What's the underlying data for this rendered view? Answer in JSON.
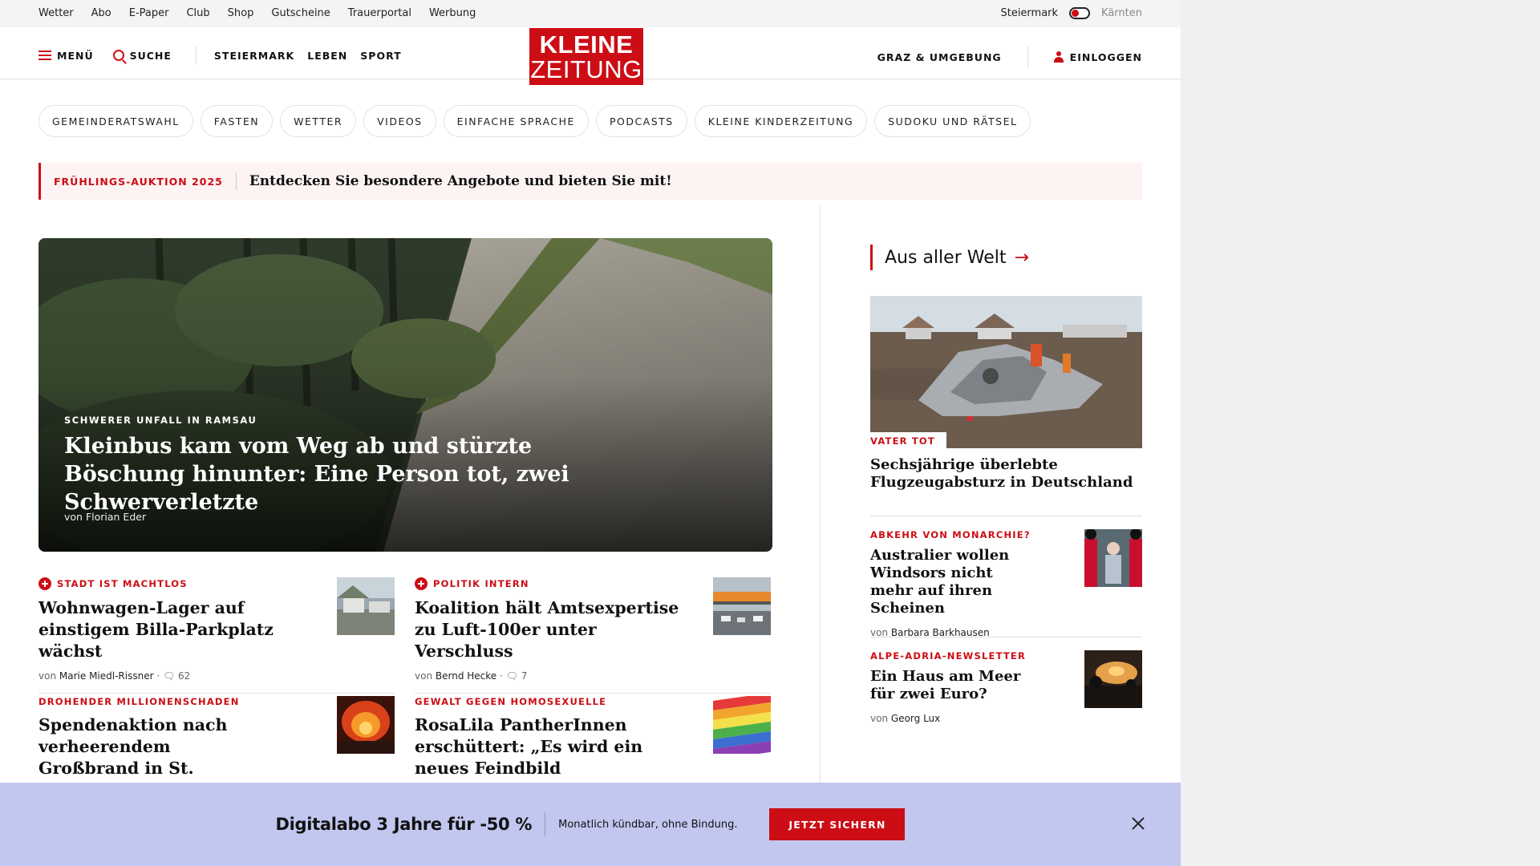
{
  "utility_bar": {
    "links": [
      "Wetter",
      "Abo",
      "E-Paper",
      "Club",
      "Shop",
      "Gutscheine",
      "Trauerportal",
      "Werbung"
    ],
    "region_selected": "Steiermark",
    "region_other": "Kärnten"
  },
  "main_nav": {
    "menu_label": "MENÜ",
    "search_label": "SUCHE",
    "sections": [
      "STEIERMARK",
      "LEBEN",
      "SPORT"
    ],
    "logo_line1": "KLEINE",
    "logo_line2": "ZEITUNG",
    "region_link": "GRAZ & UMGEBUNG",
    "login_label": "EINLOGGEN"
  },
  "topic_pills": [
    "GEMEINDERATSWAHL",
    "FASTEN",
    "WETTER",
    "VIDEOS",
    "EINFACHE SPRACHE",
    "PODCASTS",
    "KLEINE KINDERZEITUNG",
    "SUDOKU UND RÄTSEL"
  ],
  "promo": {
    "label": "FRÜHLINGS-AUKTION 2025",
    "text": "Entdecken Sie besondere Angebote und bieten Sie mit!"
  },
  "hero": {
    "kicker": "SCHWERER UNFALL IN RAMSAU",
    "title": "Kleinbus kam vom Weg ab und stürzte Böschung hinunter: Eine Person tot, zwei Schwerverletzte",
    "author": "von Florian Eder"
  },
  "articles": [
    {
      "kicker": "STADT IST MACHTLOS",
      "title": "Wohnwagen-Lager auf einstigem Billa-Parkplatz wächst",
      "author_prefix": "von",
      "author": "Marie Miedl-Rissner",
      "comments": "62",
      "premium": true
    },
    {
      "kicker": "POLITIK INTERN",
      "title": "Koalition hält Amtsexpertise zu Luft-100er unter Verschluss",
      "author_prefix": "von",
      "author": "Bernd Hecke",
      "comments": "7",
      "premium": true
    },
    {
      "kicker": "DROHENDER MILLIONENSCHADEN",
      "title": "Spendenaktion nach verheerendem Großbrand in St. Marein",
      "premium": false
    },
    {
      "kicker": "GEWALT GEGEN HOMOSEXUELLE",
      "title": "RosaLila PantherInnen erschüttert: „Es wird ein neues Feindbild aufgezogen“",
      "premium": false
    }
  ],
  "right_column": {
    "heading": "Aus aller Welt",
    "arrow": "→",
    "lead": {
      "tag": "VATER TOT",
      "title": "Sechsjährige überlebte Flugzeugabsturz in Deutschland"
    },
    "items": [
      {
        "kicker": "ABKEHR VON MONARCHIE?",
        "title": "Australier wollen Windsors nicht mehr auf ihren Scheinen",
        "author_prefix": "von",
        "author": "Barbara Barkhausen"
      },
      {
        "kicker": "ALPE-ADRIA-NEWSLETTER",
        "title": "Ein Haus am Meer für zwei Euro?",
        "author_prefix": "von",
        "author": "Georg Lux"
      }
    ]
  },
  "banner": {
    "headline": "Digitalabo 3 Jahre für -50 %",
    "subtext": "Monatlich kündbar, ohne Bindung.",
    "cta": "JETZT SICHERN"
  },
  "colors": {
    "brand_red": "#cc0d15",
    "banner_bg": "#c2c7f0",
    "promo_bg": "#fdf3f3"
  },
  "icons": {
    "menu": "hamburger-icon",
    "search": "search-icon",
    "user": "user-icon",
    "comment": "comment-icon",
    "close": "close-icon",
    "premium": "plus-icon"
  }
}
